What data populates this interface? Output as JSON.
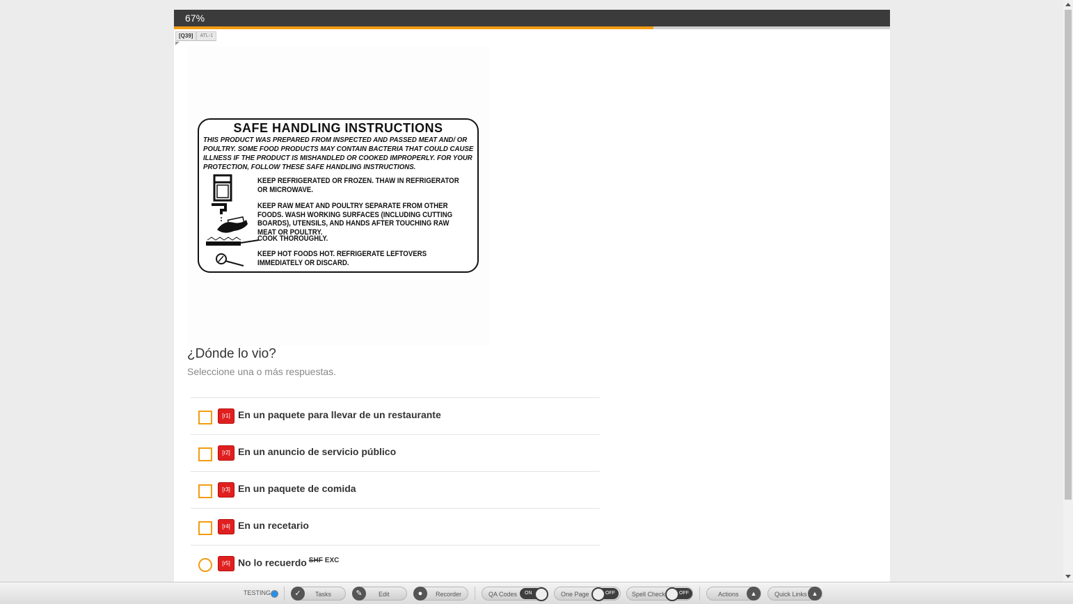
{
  "progress": {
    "label": "67%",
    "fraction": 0.67
  },
  "question_tags": {
    "id": "[Q39]",
    "atl": "ATL-1"
  },
  "label_image": {
    "title": "SAFE HANDLING INSTRUCTIONS",
    "intro": "THIS PRODUCT WAS PREPARED FROM INSPECTED AND PASSED MEAT AND/ OR POULTRY. SOME FOOD PRODUCTS MAY CONTAIN BACTERIA THAT COULD CAUSE ILLNESS IF THE PRODUCT IS MISHANDLED OR COOKED IMPROPERLY. FOR YOUR PROTECTION, FOLLOW THESE SAFE HANDLING INSTRUCTIONS.",
    "rules": [
      "KEEP REFRIGERATED OR FROZEN. THAW IN REFRIGERATOR OR MICROWAVE.",
      "KEEP RAW MEAT AND POULTRY SEPARATE FROM OTHER FOODS. WASH WORKING SURFACES (INCLUDING CUTTING BOARDS), UTENSILS, AND HANDS AFTER TOUCHING RAW MEAT OR POULTRY.",
      "COOK THOROUGHLY.",
      "KEEP HOT FOODS HOT.   REFRIGERATE LEFTOVERS IMMEDIATELY OR DISCARD."
    ],
    "icons": [
      "refrigerator-icon",
      "faucet-hands-icon",
      "cooking-pan-icon",
      "thermometer-icon"
    ]
  },
  "question": {
    "text": "¿Dónde lo vio?",
    "instruction": "Seleccione una o más respuestas."
  },
  "answers": [
    {
      "code": "[r1]",
      "label": "En un paquete para llevar de un restaurante",
      "type": "checkbox"
    },
    {
      "code": "[r2]",
      "label": "En un anuncio de servicio público",
      "type": "checkbox"
    },
    {
      "code": "[r3]",
      "label": "En un paquete de comida",
      "type": "checkbox"
    },
    {
      "code": "[r4]",
      "label": "En un recetario",
      "type": "checkbox"
    },
    {
      "code": "[r5]",
      "label": "No lo recuerdo",
      "type": "radio",
      "tag_shf": "SHF",
      "tag_exc": "EXC"
    }
  ],
  "footer": {
    "testing": "TESTING",
    "tasks": "Tasks",
    "edit": "Edit",
    "recorder": "Recorder",
    "qa_codes": "QA Codes",
    "qa_codes_state": "ON",
    "one_page": "One Page",
    "one_page_state": "OFF",
    "spell_check": "Spell Check",
    "spell_check_state": "OFF",
    "actions": "Actions",
    "quick_links": "Quick Links"
  },
  "colors": {
    "accent": "#f39c12",
    "badge": "#e02020",
    "header": "#3b3b3b"
  }
}
